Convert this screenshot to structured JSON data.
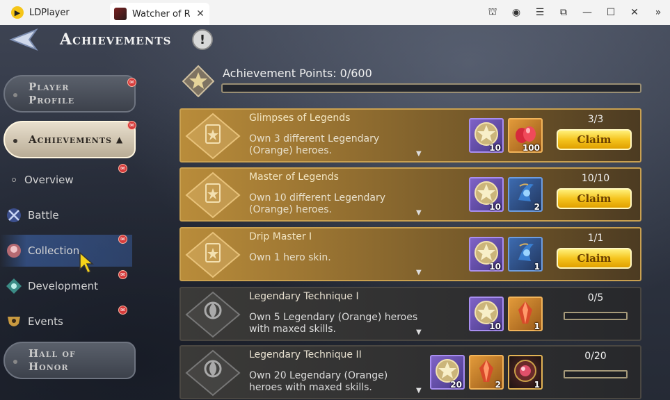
{
  "window": {
    "app_name": "LDPlayer",
    "tab_title": "Watcher of R...",
    "tab_close": "✕",
    "controls": [
      "⛫",
      "◉",
      "☰",
      "⧉",
      "—",
      "☐",
      "✕",
      "»"
    ]
  },
  "header": {
    "title": "Achievements",
    "info_glyph": "!"
  },
  "sidebar": {
    "player_profile": [
      "Player",
      "Profile"
    ],
    "achievements": "Achievements",
    "achievements_caret": "▲",
    "items": [
      {
        "label": "Overview"
      },
      {
        "label": "Battle"
      },
      {
        "label": "Collection"
      },
      {
        "label": "Development"
      },
      {
        "label": "Events"
      }
    ],
    "hall_of_honor": [
      "Hall of",
      "Honor"
    ]
  },
  "points": {
    "label": "Achievement Points:  0/600",
    "current": 0,
    "max": 600
  },
  "achievements": [
    {
      "title": "Glimpses of Legends",
      "desc": "Own 3 different Legendary (Orange) heroes.",
      "progress": "3/3",
      "claim": "Claim",
      "rewards": [
        {
          "type": "purple",
          "icon": "star-medal-icon",
          "count": "10"
        },
        {
          "type": "orange",
          "icon": "ruby-icon",
          "count": "100"
        }
      ]
    },
    {
      "title": "Master of Legends",
      "desc": "Own 10 different Legendary (Orange) heroes.",
      "progress": "10/10",
      "claim": "Claim",
      "rewards": [
        {
          "type": "purple",
          "icon": "star-medal-icon",
          "count": "10"
        },
        {
          "type": "blue",
          "icon": "blue-relic-icon",
          "count": "2"
        }
      ]
    },
    {
      "title": "Drip Master I",
      "desc": "Own 1 hero skin.",
      "progress": "1/1",
      "claim": "Claim",
      "rewards": [
        {
          "type": "purple",
          "icon": "star-medal-icon",
          "count": "10"
        },
        {
          "type": "blue",
          "icon": "blue-relic-icon",
          "count": "1"
        }
      ]
    },
    {
      "title": "Legendary Technique I",
      "desc": "Own 5 Legendary (Orange) heroes with maxed skills.",
      "progress": "0/5",
      "rewards": [
        {
          "type": "purple",
          "icon": "star-medal-icon",
          "count": "10"
        },
        {
          "type": "orange",
          "icon": "crystal-icon",
          "count": "1"
        }
      ]
    },
    {
      "title": "Legendary Technique II",
      "desc": "Own 20 Legendary (Orange) heroes with maxed skills.",
      "progress": "0/20",
      "rewards": [
        {
          "type": "purple",
          "icon": "star-medal-icon",
          "count": "20"
        },
        {
          "type": "orange",
          "icon": "crystal-icon",
          "count": "2"
        },
        {
          "type": "dark",
          "icon": "red-orb-icon",
          "count": "1"
        }
      ]
    }
  ],
  "colors": {
    "gold": "#c9a645",
    "badge": "#d63b3b",
    "claim": "#f5c41e"
  }
}
